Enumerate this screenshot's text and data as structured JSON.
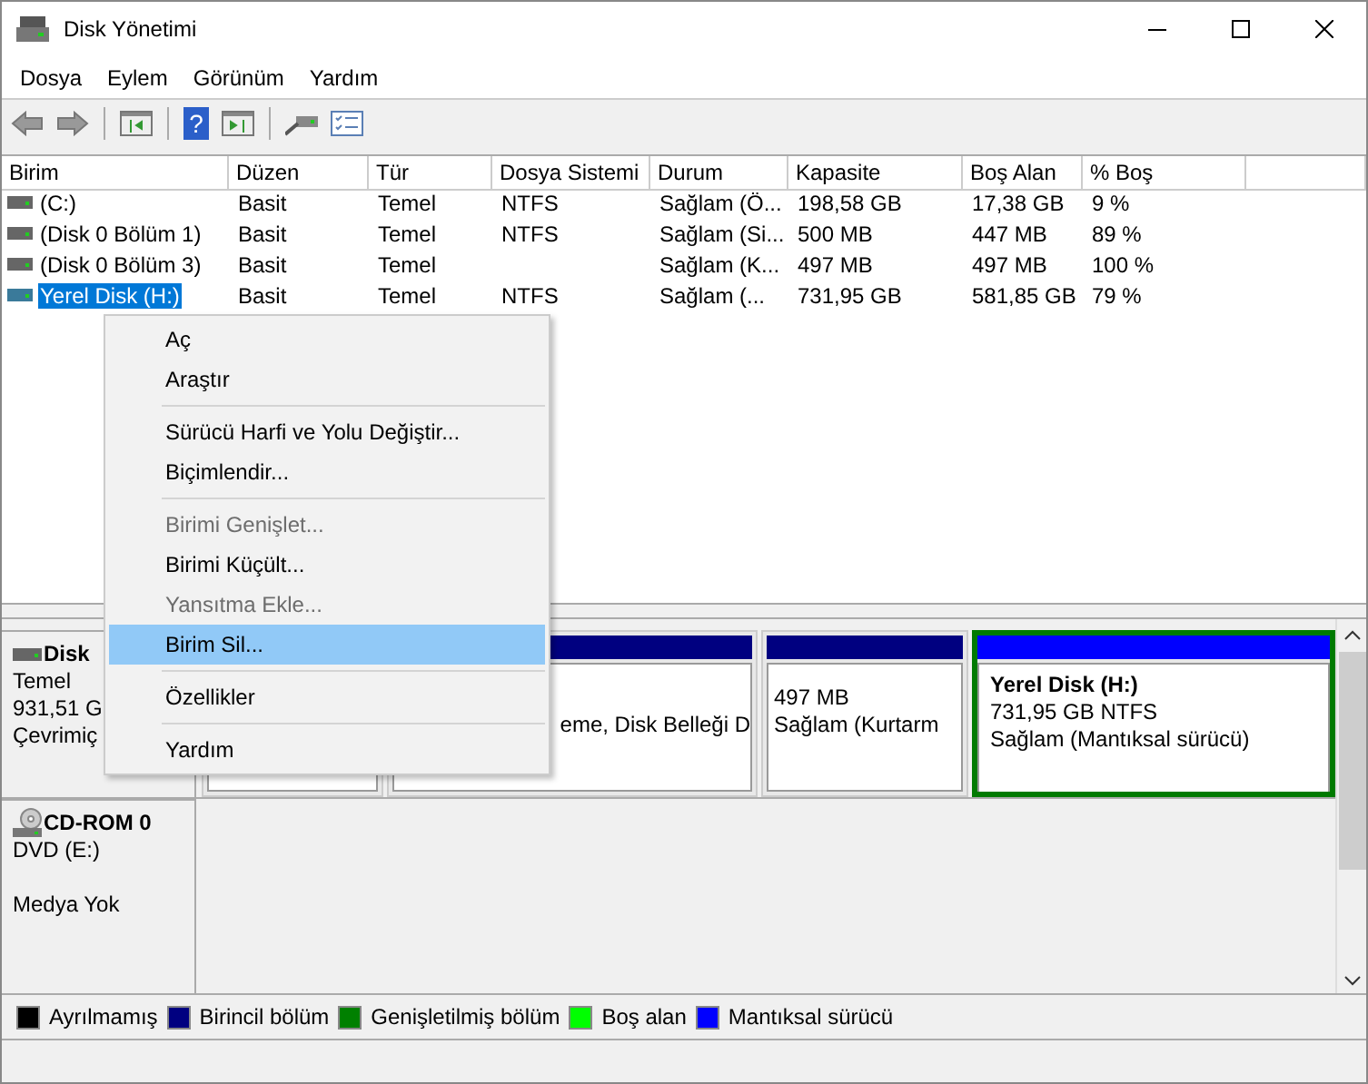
{
  "window": {
    "title": "Disk Yönetimi"
  },
  "menu_bar": [
    "Dosya",
    "Eylem",
    "Görünüm",
    "Yardım"
  ],
  "help_button": {
    "label": "?"
  },
  "table": {
    "columns": [
      "Birim",
      "Düzen",
      "Tür",
      "Dosya Sistemi",
      "Durum",
      "Kapasite",
      "Boş Alan",
      "% Boş"
    ],
    "rows": [
      {
        "cells": [
          "(C:)",
          "Basit",
          "Temel",
          "NTFS",
          "Sağlam (Ö...",
          "198,58 GB",
          "17,38 GB",
          "9 %"
        ],
        "selected": false
      },
      {
        "cells": [
          "(Disk 0 Bölüm 1)",
          "Basit",
          "Temel",
          "NTFS",
          "Sağlam (Si...",
          "500 MB",
          "447 MB",
          "89 %"
        ],
        "selected": false
      },
      {
        "cells": [
          "(Disk 0 Bölüm 3)",
          "Basit",
          "Temel",
          "",
          "Sağlam (K...",
          "497 MB",
          "497 MB",
          "100 %"
        ],
        "selected": false
      },
      {
        "cells": [
          "Yerel Disk (H:)",
          "Basit",
          "Temel",
          "NTFS",
          "Sağlam (...",
          "731,95 GB",
          "581,85 GB",
          "79 %"
        ],
        "selected": true
      }
    ]
  },
  "context_menu": {
    "items": [
      {
        "kind": "item",
        "label": "Aç",
        "disabled": false,
        "selected": false
      },
      {
        "kind": "item",
        "label": "Araştır",
        "disabled": false,
        "selected": false
      },
      {
        "kind": "separator"
      },
      {
        "kind": "item",
        "label": "Sürücü Harfi ve Yolu Değiştir...",
        "disabled": false,
        "selected": false
      },
      {
        "kind": "item",
        "label": "Biçimlendir...",
        "disabled": false,
        "selected": false
      },
      {
        "kind": "separator"
      },
      {
        "kind": "item",
        "label": "Birimi Genişlet...",
        "disabled": true,
        "selected": false
      },
      {
        "kind": "item",
        "label": "Birimi Küçült...",
        "disabled": false,
        "selected": false
      },
      {
        "kind": "item",
        "label": "Yansıtma Ekle...",
        "disabled": true,
        "selected": false
      },
      {
        "kind": "item",
        "label": "Birim Sil...",
        "disabled": false,
        "selected": true
      },
      {
        "kind": "separator"
      },
      {
        "kind": "item",
        "label": "Özellikler",
        "disabled": false,
        "selected": false
      },
      {
        "kind": "separator"
      },
      {
        "kind": "item",
        "label": "Yardım",
        "disabled": false,
        "selected": false
      }
    ]
  },
  "disks": [
    {
      "kind": "disk",
      "name": "Disk",
      "lines": [
        "Temel",
        "931,51 G",
        "Çevrimiç"
      ],
      "partitions": [
        {
          "selected": false
        },
        {
          "color": "#000080",
          "selected": false,
          "lines": [
            "eme, Disk Belleği D"
          ]
        },
        {
          "color": "#000080",
          "selected": false,
          "lines": [
            "497 MB",
            "Sağlam (Kurtarm"
          ]
        },
        {
          "color": "#0000ff",
          "selected": true,
          "title": "Yerel Disk  (H:)",
          "lines": [
            "731,95 GB NTFS",
            "Sağlam (Mantıksal sürücü)"
          ]
        }
      ]
    },
    {
      "kind": "cdrom",
      "name": "CD-ROM 0",
      "lines": [
        "DVD (E:)",
        "Medya Yok"
      ]
    }
  ],
  "legend": [
    {
      "label": "Ayrılmamış",
      "color": "#000000"
    },
    {
      "label": "Birincil bölüm",
      "color": "#000080"
    },
    {
      "label": "Genişletilmiş bölüm",
      "color": "#008000"
    },
    {
      "label": "Boş alan",
      "color": "#00ff00"
    },
    {
      "label": "Mantıksal sürücü",
      "color": "#0000ff"
    }
  ]
}
